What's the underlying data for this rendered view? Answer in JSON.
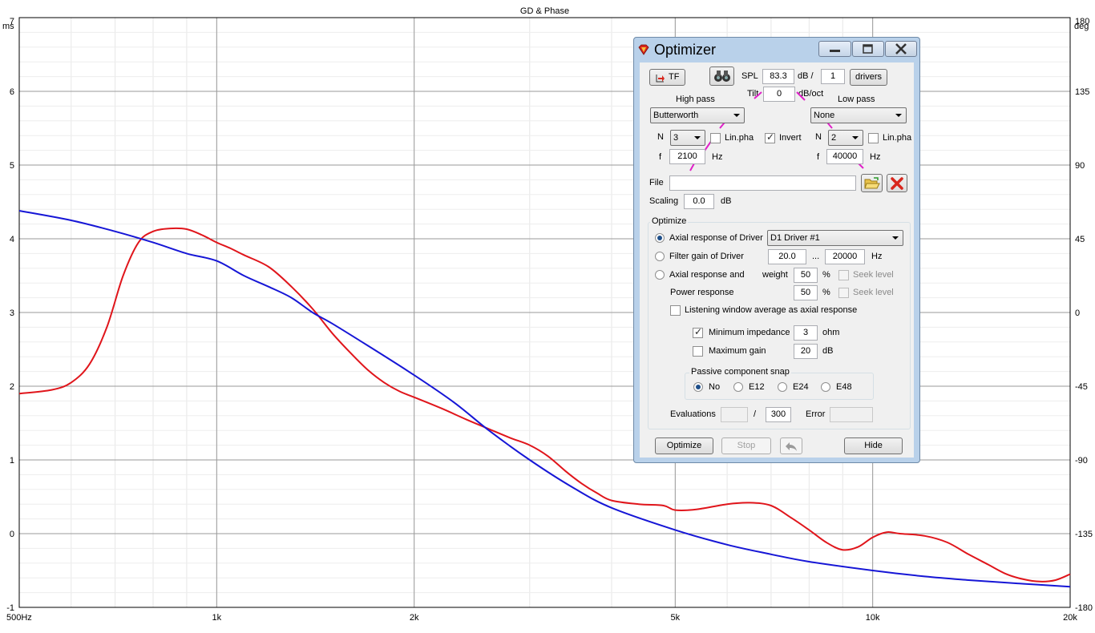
{
  "chart_data": {
    "type": "line",
    "title": "GD & Phase",
    "left_axis_unit": "ms",
    "right_axis_unit": "deg",
    "x_scale": "log",
    "xlim": [
      500,
      20000
    ],
    "ylim_left": [
      -1,
      7
    ],
    "ylim_right": [
      -180,
      180
    ],
    "grid": true,
    "x_ticks": [
      {
        "value": 500,
        "label": "500Hz"
      },
      {
        "value": 1000,
        "label": "1k"
      },
      {
        "value": 2000,
        "label": "2k"
      },
      {
        "value": 5000,
        "label": "5k"
      },
      {
        "value": 10000,
        "label": "10k"
      },
      {
        "value": 20000,
        "label": "20k"
      }
    ],
    "y_ticks_left": [
      "-1",
      "0",
      "1",
      "2",
      "3",
      "4",
      "5",
      "6",
      "7"
    ],
    "y_ticks_right": [
      "-180",
      "-135",
      "-90",
      "-45",
      "0",
      "45",
      "90",
      "135",
      "180"
    ],
    "series": [
      {
        "color": "#e0151b",
        "x": [
          500,
          560,
          600,
          640,
          680,
          720,
          760,
          800,
          850,
          900,
          950,
          1000,
          1050,
          1100,
          1200,
          1300,
          1400,
          1500,
          1600,
          1700,
          1800,
          1900,
          2000,
          2200,
          2400,
          2600,
          2800,
          3000,
          3200,
          3400,
          3600,
          3800,
          4000,
          4400,
          4800,
          5000,
          5400,
          6000,
          6500,
          7000,
          7500,
          8000,
          8500,
          9000,
          9500,
          10000,
          10500,
          11000,
          12000,
          13000,
          14000,
          15000,
          16000,
          17000,
          18000,
          19000,
          20000
        ],
        "y": [
          1.9,
          1.95,
          2.05,
          2.3,
          2.8,
          3.5,
          3.95,
          4.1,
          4.14,
          4.13,
          4.05,
          3.95,
          3.87,
          3.78,
          3.62,
          3.35,
          3.05,
          2.72,
          2.45,
          2.22,
          2.05,
          1.93,
          1.85,
          1.7,
          1.55,
          1.42,
          1.3,
          1.2,
          1.05,
          0.85,
          0.68,
          0.55,
          0.45,
          0.4,
          0.38,
          0.32,
          0.33,
          0.4,
          0.42,
          0.38,
          0.22,
          0.05,
          -0.12,
          -0.22,
          -0.18,
          -0.05,
          0.02,
          0.0,
          -0.03,
          -0.12,
          -0.28,
          -0.42,
          -0.55,
          -0.62,
          -0.65,
          -0.63,
          -0.55
        ]
      },
      {
        "color": "#1616d6",
        "x": [
          500,
          600,
          700,
          800,
          900,
          1000,
          1100,
          1200,
          1300,
          1400,
          1500,
          1700,
          2000,
          2300,
          2600,
          3000,
          3500,
          4000,
          5000,
          6000,
          7000,
          8000,
          10000,
          12000,
          14000,
          17000,
          20000
        ],
        "y": [
          4.38,
          4.25,
          4.1,
          3.95,
          3.8,
          3.7,
          3.5,
          3.35,
          3.2,
          3.0,
          2.85,
          2.55,
          2.15,
          1.78,
          1.4,
          1.0,
          0.62,
          0.35,
          0.05,
          -0.15,
          -0.28,
          -0.38,
          -0.5,
          -0.58,
          -0.63,
          -0.68,
          -0.72
        ]
      }
    ]
  },
  "optimizer": {
    "title": "Optimizer",
    "tf_label": "TF",
    "spl_label": "SPL",
    "spl_value": "83.3",
    "db_slash": "dB /",
    "drivers_count": "1",
    "drivers_label": "drivers",
    "tilt_label": "Tilt",
    "tilt_value": "0",
    "tilt_unit": "dB/oct",
    "highpass": {
      "label": "High pass",
      "type": "Butterworth",
      "n_label": "N",
      "n_value": "3",
      "linpha_label": "Lin.pha",
      "invert_label": "Invert",
      "f_label": "f",
      "f_value": "2100",
      "hz": "Hz"
    },
    "lowpass": {
      "label": "Low pass",
      "type": "None",
      "n_label": "N",
      "n_value": "2",
      "linpha_label": "Lin.pha",
      "f_label": "f",
      "f_value": "40000",
      "hz": "Hz"
    },
    "file_label": "File",
    "file_value": "",
    "scaling_label": "Scaling",
    "scaling_value": "0.0",
    "scaling_unit": "dB",
    "optimize_group": "Optimize",
    "opt_axial_driver": "Axial response of Driver",
    "driver_select": "D1 Driver #1",
    "opt_filter_gain": "Filter gain of Driver",
    "range_lo": "20.0",
    "range_dots": "...",
    "range_hi": "20000",
    "range_unit": "Hz",
    "opt_axial_and": "Axial response and",
    "weight_label": "weight",
    "weight_axial": "50",
    "percent": "%",
    "seek_level": "Seek level",
    "power_response": "Power response",
    "weight_power": "50",
    "listening_window": "Listening window average as axial response",
    "min_impedance_label": "Minimum impedance",
    "min_impedance_value": "3",
    "min_impedance_unit": "ohm",
    "max_gain_label": "Maximum gain",
    "max_gain_value": "20",
    "max_gain_unit": "dB",
    "snap_group": "Passive component snap",
    "snap_no": "No",
    "snap_e12": "E12",
    "snap_e24": "E24",
    "snap_e48": "E48",
    "evaluations_label": "Evaluations",
    "evaluations_value": "",
    "evaluations_slash": "/",
    "evaluations_max": "300",
    "error_label": "Error",
    "error_value": "",
    "btn_optimize": "Optimize",
    "btn_stop": "Stop",
    "btn_hide": "Hide"
  }
}
